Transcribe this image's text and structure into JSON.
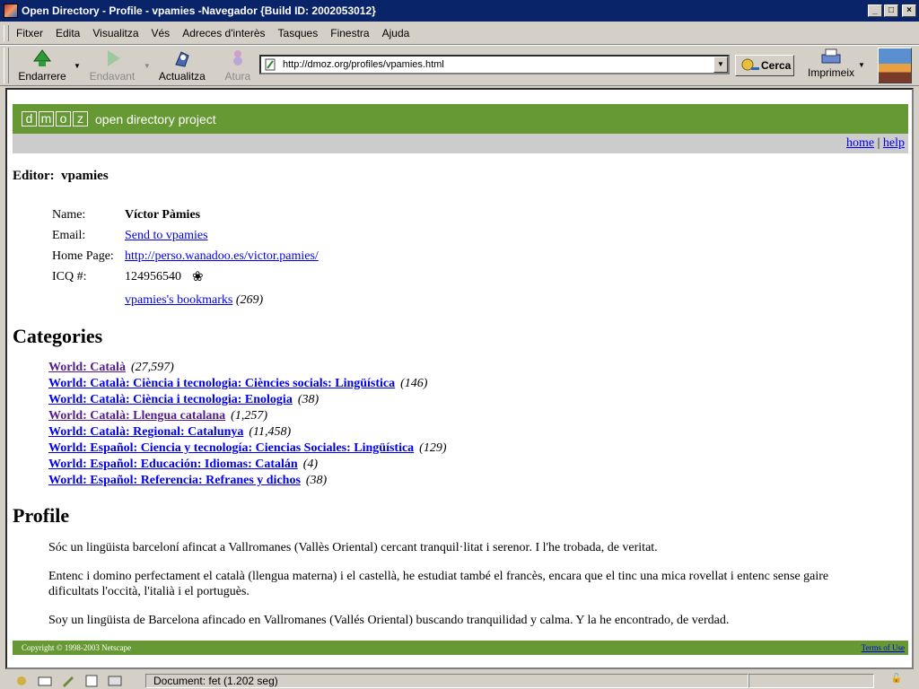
{
  "window": {
    "title": "Open Directory - Profile - vpamies -Navegador {Build ID: 2002053012}",
    "controls": [
      "minimize",
      "maximize",
      "close"
    ]
  },
  "menu": [
    "Fitxer",
    "Edita",
    "Visualitza",
    "Vés",
    "Adreces d'interès",
    "Tasques",
    "Finestra",
    "Ajuda"
  ],
  "toolbar": {
    "back": "Endarrere",
    "forward": "Endavant",
    "reload": "Actualitza",
    "stop": "Atura",
    "search": "Cerca",
    "print": "Imprimeix",
    "url": "http://dmoz.org/profiles/vpamies.html"
  },
  "page": {
    "logo_letters": [
      "d",
      "m",
      "o",
      "z"
    ],
    "tagline": "open directory project",
    "top_links": [
      "home",
      "help"
    ],
    "editor_label": "Editor:",
    "editor_name": "vpamies",
    "fields": {
      "name_label": "Name:",
      "name_value": "Víctor Pàmies",
      "email_label": "Email:",
      "email_value": "Send to vpamies",
      "homepage_label": "Home Page:",
      "homepage_value": "http://perso.wanadoo.es/victor.pamies/",
      "icq_label": "ICQ #:",
      "icq_value": "124956540",
      "bookmarks_link": "vpamies's bookmarks",
      "bookmarks_count": "(269)"
    },
    "categories_heading": "Categories",
    "categories": [
      {
        "name": "World: Català",
        "count": "(27,597)",
        "visited": true
      },
      {
        "name": "World: Català: Ciència i tecnologia: Ciències socials: Lingüística",
        "count": "(146)",
        "visited": false
      },
      {
        "name": "World: Català: Ciència i tecnologia: Enologia",
        "count": "(38)",
        "visited": false
      },
      {
        "name": "World: Català: Llengua catalana",
        "count": "(1,257)",
        "visited": true
      },
      {
        "name": "World: Català: Regional: Catalunya",
        "count": "(11,458)",
        "visited": false
      },
      {
        "name": "World: Español: Ciencia y tecnología: Ciencias Sociales: Lingüística",
        "count": "(129)",
        "visited": false
      },
      {
        "name": "World: Español: Educación: Idiomas: Catalán",
        "count": "(4)",
        "visited": false
      },
      {
        "name": "World: Español: Referencia: Refranes y dichos",
        "count": "(38)",
        "visited": false
      }
    ],
    "profile_heading": "Profile",
    "profile_paragraphs": [
      "Sóc un lingüista barceloní afincat a Vallromanes (Vallès Oriental) cercant tranquil·litat i serenor. I l'he trobada, de veritat.",
      "Entenc i domino perfectament el català (llengua materna) i el castellà, he estudiat també el francès, encara que el tinc una mica rovellat i entenc sense gaire dificultats l'occità, l'italià i el portuguès.",
      "Soy un lingüista de Barcelona afincado en Vallromanes (Vallés Oriental) buscando tranquilidad y calma. Y la he encontrado, de verdad."
    ],
    "copyright": "Copyright © 1998-2003 Netscape",
    "terms": "Terms of Use"
  },
  "status": {
    "text": "Document: fet (1.202 seg)"
  }
}
